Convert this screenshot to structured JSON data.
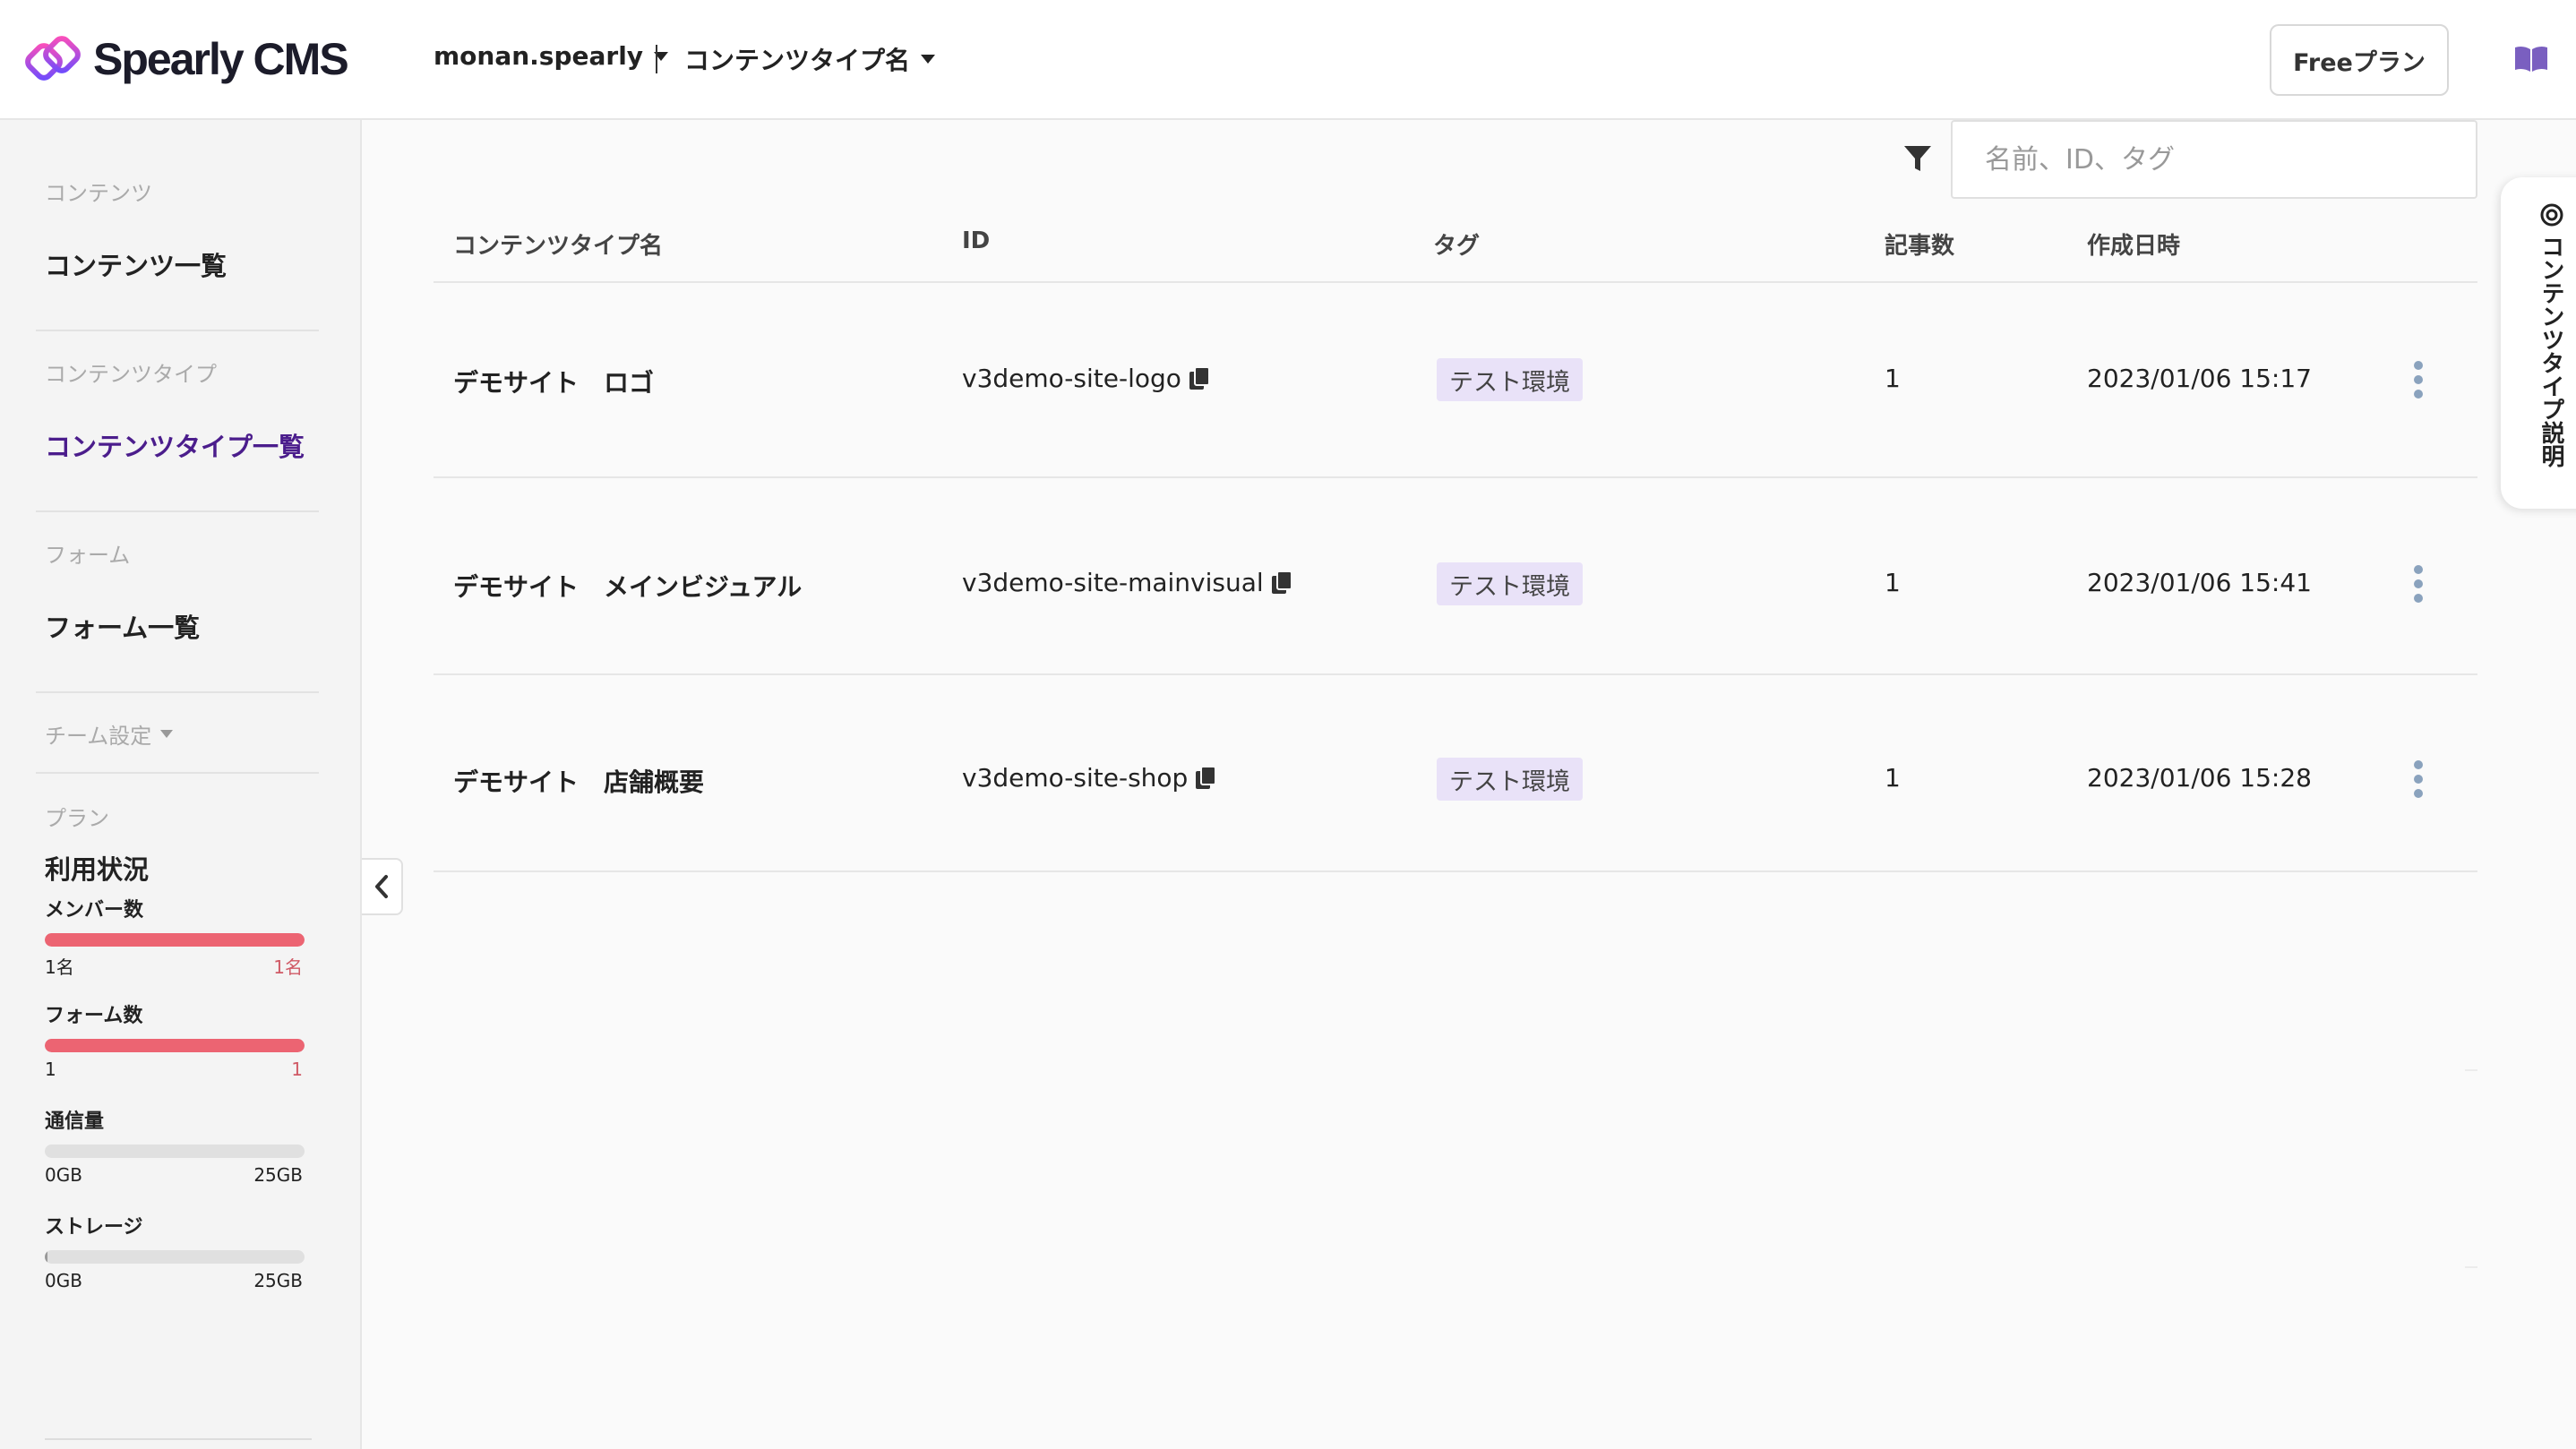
{
  "header": {
    "app_name": "Spearly CMS",
    "team": "monan.spearly",
    "content_type_selector": "コンテンツタイプ名",
    "plan_button": "Freeプラン"
  },
  "sidebar": {
    "content_section": "コンテンツ",
    "content_list": "コンテンツ一覧",
    "content_type_section": "コンテンツタイプ",
    "content_type_list": "コンテンツタイプ一覧",
    "form_section": "フォーム",
    "form_list": "フォーム一覧",
    "team_settings": "チーム設定",
    "plan_section": "プラン",
    "usage_title": "利用状況",
    "usage": [
      {
        "label": "メンバー数",
        "min": "1名",
        "max": "1名",
        "ratio": 1.0,
        "color": "#ec6472"
      },
      {
        "label": "フォーム数",
        "min": "1",
        "max": "1",
        "ratio": 1.0,
        "color": "#ec6472"
      },
      {
        "label": "通信量",
        "min": "0GB",
        "max": "25GB",
        "ratio": 0.0,
        "color": "#ec6472"
      },
      {
        "label": "ストレージ",
        "min": "0GB",
        "max": "25GB",
        "ratio": 0.003,
        "color": "#999999"
      }
    ]
  },
  "search": {
    "placeholder": "名前、ID、タグ"
  },
  "table": {
    "columns": [
      "コンテンツタイプ名",
      "ID",
      "タグ",
      "記事数",
      "作成日時"
    ],
    "rows": [
      {
        "name": "デモサイト　ロゴ",
        "id": "v3demo-site-logo",
        "tag": "テスト環境",
        "count": "1",
        "created": "2023/01/06 15:17"
      },
      {
        "name": "デモサイト　メインビジュアル",
        "id": "v3demo-site-mainvisual",
        "tag": "テスト環境",
        "count": "1",
        "created": "2023/01/06 15:41"
      },
      {
        "name": "デモサイト　店舗概要",
        "id": "v3demo-site-shop",
        "tag": "テスト環境",
        "count": "1",
        "created": "2023/01/06 15:28"
      }
    ]
  },
  "side_tab": {
    "label": "コンテンツタイプ説明"
  },
  "colors": {
    "accent": "#4b1d8c",
    "tag_bg": "#e9e2f8",
    "usage_full": "#ec6472"
  }
}
